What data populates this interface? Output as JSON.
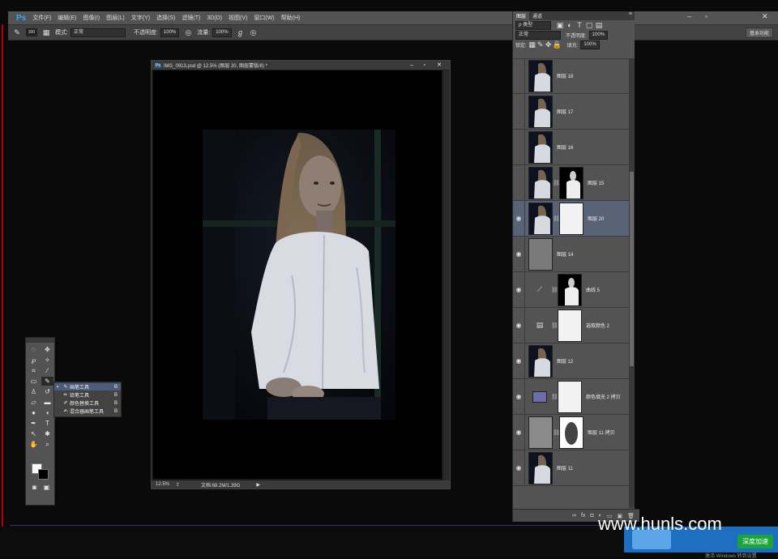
{
  "app": {
    "logo": "Ps"
  },
  "menubar": {
    "items": [
      "文件(F)",
      "编辑(E)",
      "图像(I)",
      "图层(L)",
      "文字(Y)",
      "选择(S)",
      "滤镜(T)",
      "3D(D)",
      "视图(V)",
      "窗口(W)",
      "帮助(H)"
    ],
    "minimize": "–",
    "restore": "▫",
    "close": "✕"
  },
  "options": {
    "brush_size": "300",
    "mode_label": "模式:",
    "mode_value": "正常",
    "opacity_label": "不透明度:",
    "opacity_value": "100%",
    "flow_label": "流量:",
    "flow_value": "100%",
    "workspace": "基本功能"
  },
  "document": {
    "title": "IMG_0913.psd @ 12.5% (图层 20, 图层蒙版/8) *",
    "zoom": "12.5%",
    "doc_info": "文档:68.2M/1.39G",
    "ps_badge": "Ps"
  },
  "flyout": {
    "items": [
      {
        "label": "画笔工具",
        "key": "B",
        "selected": true
      },
      {
        "label": "铅笔工具",
        "key": "B",
        "selected": false
      },
      {
        "label": "颜色替换工具",
        "key": "B",
        "selected": false
      },
      {
        "label": "混合器画笔工具",
        "key": "B",
        "selected": false
      }
    ]
  },
  "layers_panel": {
    "tabs": [
      "图层",
      "通道"
    ],
    "filter_label": "ρ 类型",
    "blend_mode": "正常",
    "opacity_label": "不透明度:",
    "opacity_value": "100%",
    "lock_label": "锁定:",
    "fill_label": "填充:",
    "fill_value": "100%",
    "layers": [
      {
        "name": "图层 18",
        "visible": false,
        "kind": "photo"
      },
      {
        "name": "图层 17",
        "visible": false,
        "kind": "photo"
      },
      {
        "name": "图层 16",
        "visible": false,
        "kind": "photo"
      },
      {
        "name": "图层 15",
        "visible": false,
        "kind": "photo-mask-dark"
      },
      {
        "name": "图层 20",
        "visible": true,
        "kind": "photo-mask-white",
        "selected": true
      },
      {
        "name": "图层 14",
        "visible": true,
        "kind": "gray"
      },
      {
        "name": "曲线 5",
        "visible": true,
        "kind": "curves-mask"
      },
      {
        "name": "选取颜色 2",
        "visible": true,
        "kind": "selective-mask"
      },
      {
        "name": "图层 12",
        "visible": true,
        "kind": "photo"
      },
      {
        "name": "颜色填充 2 拷贝",
        "visible": true,
        "kind": "fill-mask"
      },
      {
        "name": "图层 11 拷贝",
        "visible": true,
        "kind": "noise-mask"
      },
      {
        "name": "图层 11",
        "visible": true,
        "kind": "photo"
      }
    ]
  },
  "watermark": {
    "text": "www.hunls.com",
    "button": "深度加速"
  },
  "taskbar": {
    "text": "激活 Windows 转到设置"
  }
}
